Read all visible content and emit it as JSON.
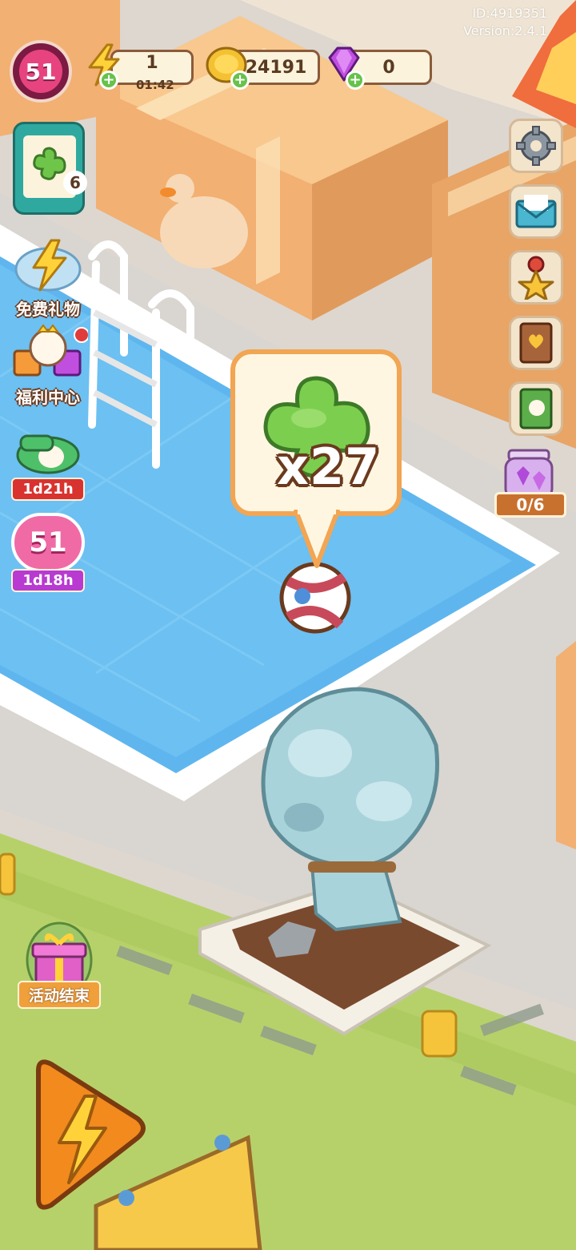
{
  "hud": {
    "id_text": "ID:4919351",
    "version_text": "Version:2.4.1",
    "level": "51",
    "energy": {
      "value": "1",
      "timer": "01:42"
    },
    "coins": {
      "value": "24191"
    },
    "gems": {
      "value": "0"
    }
  },
  "task_board": {
    "count": "6"
  },
  "left_menu": {
    "free_gift_label": "免费礼物",
    "welfare_label": "福利中心",
    "event1_timer": "1d21h",
    "event2_level": "51",
    "event2_timer": "1d18h",
    "activity_label": "活动结束"
  },
  "right_menu": {
    "items": [
      "settings-icon",
      "mail-icon",
      "medal-icon",
      "journal-icon",
      "collection-book-icon"
    ],
    "jar_progress": "0/6"
  },
  "bubble": {
    "count_text": "x27",
    "item_icon": "clover-leaf-icon"
  },
  "colors": {
    "pool_water": "#5fb6ee",
    "grass": "#b7d16a",
    "box": "#f2b072",
    "accent_orange": "#f2a552",
    "level_pink": "#e7447f"
  }
}
